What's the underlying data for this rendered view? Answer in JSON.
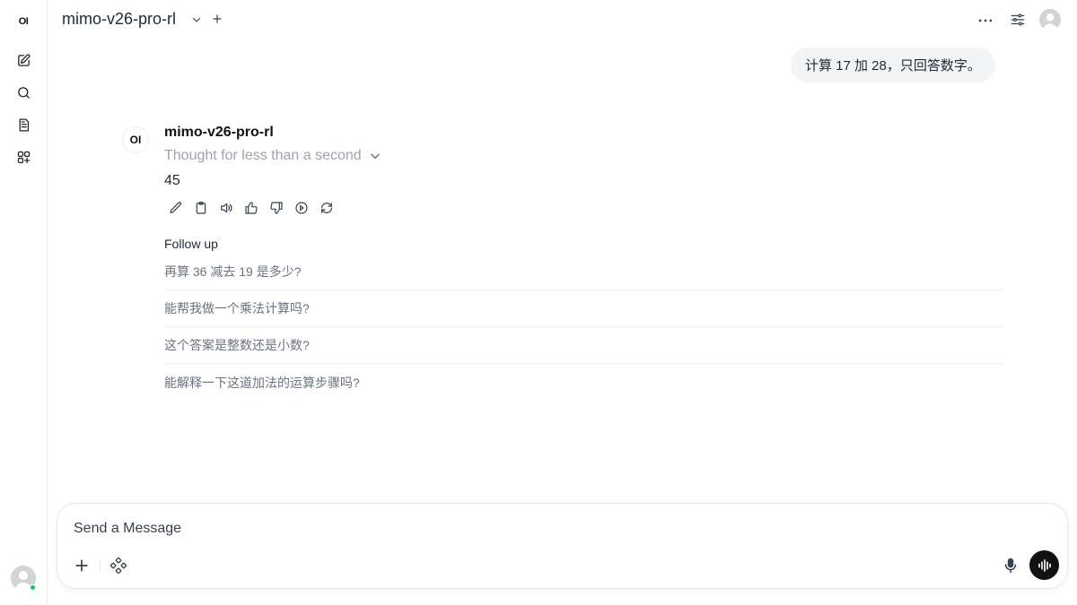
{
  "sidebar": {
    "logo": "OI",
    "items": [
      {
        "name": "new-chat"
      },
      {
        "name": "search"
      },
      {
        "name": "notes"
      },
      {
        "name": "workspace"
      }
    ]
  },
  "header": {
    "model_title": "mimo-v26-pro-rl"
  },
  "chat": {
    "user_message": "计算 17 加 28，只回答数字。",
    "assistant": {
      "avatar": "OI",
      "name": "mimo-v26-pro-rl",
      "thought": "Thought for less than a second",
      "answer": "45"
    },
    "followup_title": "Follow up",
    "followups": [
      "再算 36 减去 19 是多少?",
      "能帮我做一个乘法计算吗?",
      "这个答案是整数还是小数?",
      "能解释一下这道加法的运算步骤吗?"
    ]
  },
  "composer": {
    "placeholder": "Send a Message"
  }
}
